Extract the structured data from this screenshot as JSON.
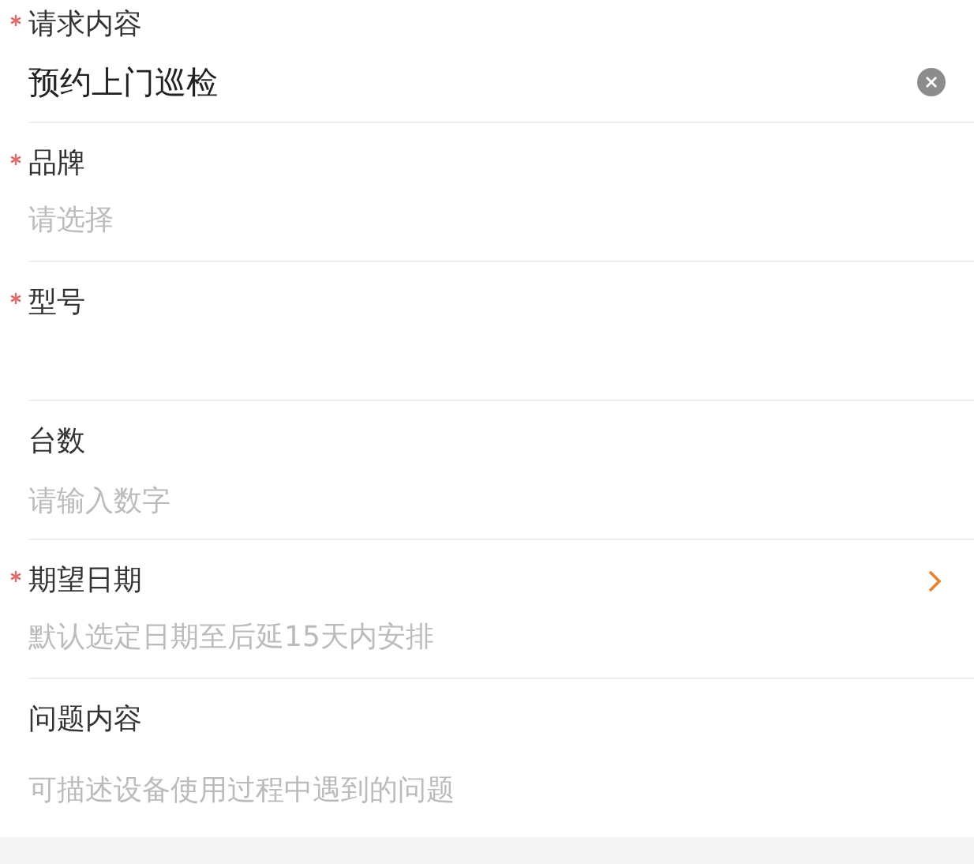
{
  "fields": [
    {
      "label": "请求内容",
      "required": true,
      "kind": "text",
      "value": "预约上门巡检",
      "clearable": true
    },
    {
      "label": "品牌",
      "required": true,
      "kind": "select",
      "placeholder": "请选择"
    },
    {
      "label": "型号",
      "required": true,
      "kind": "text"
    },
    {
      "label": "台数",
      "required": false,
      "kind": "number",
      "placeholder": "请输入数字"
    },
    {
      "label": "期望日期",
      "required": true,
      "kind": "date",
      "placeholder": "默认选定日期至后延15天内安排"
    },
    {
      "label": "问题内容",
      "required": false,
      "kind": "textarea",
      "placeholder": "可描述设备使用过程中遇到的问题"
    }
  ]
}
